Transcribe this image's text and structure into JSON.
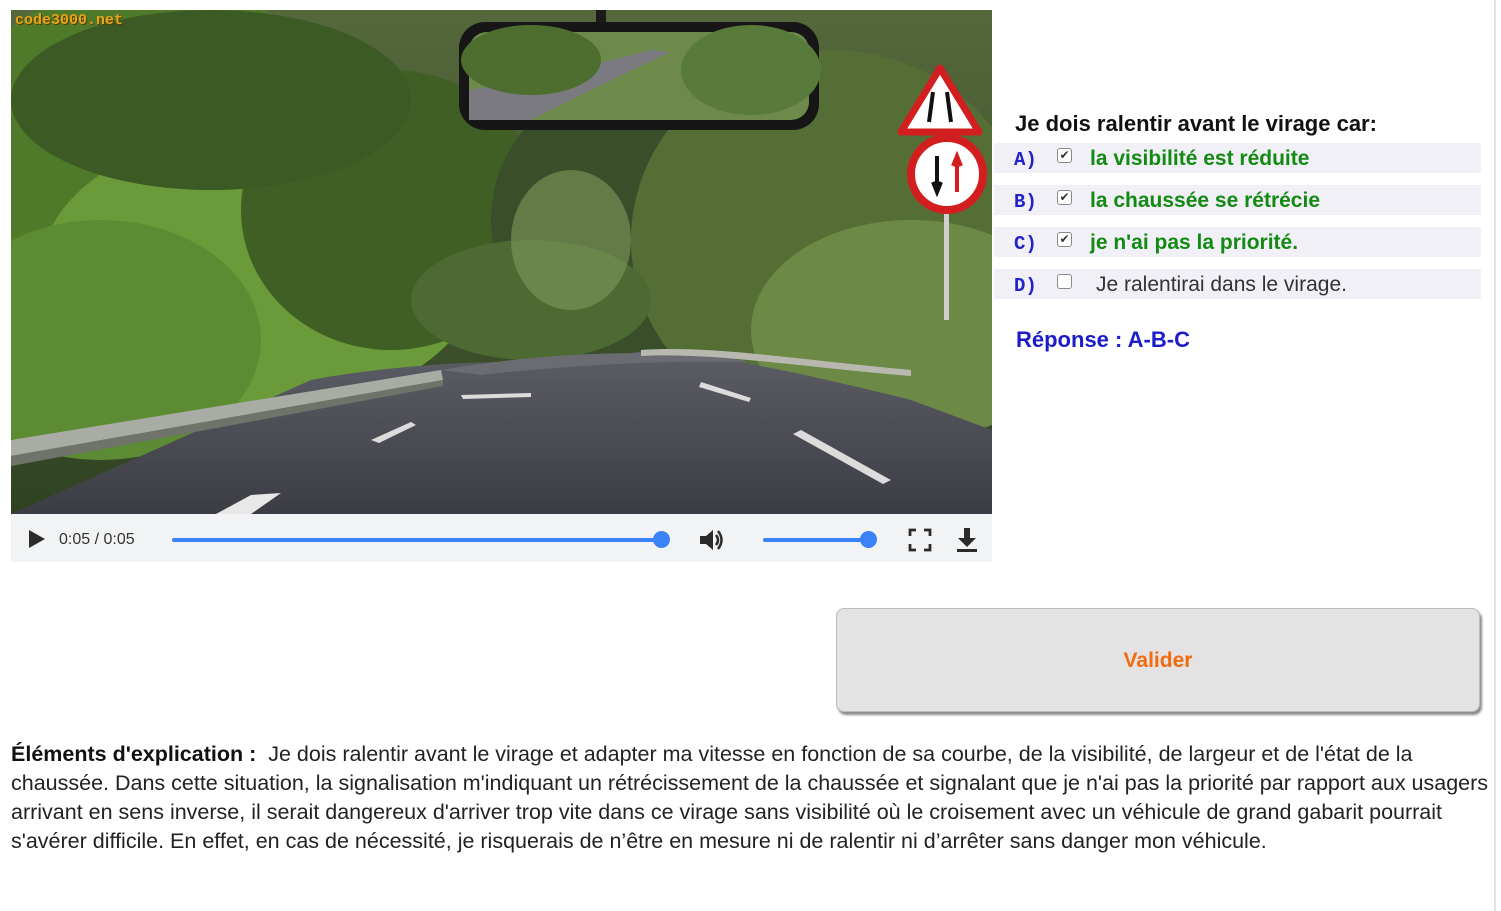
{
  "video": {
    "watermark": "code3000.net",
    "current_time": "0:05",
    "duration": "0:05",
    "progress_fraction": 1.0,
    "volume_fraction": 1.0
  },
  "question": {
    "title": "Je dois ralentir avant le virage car:",
    "answers": [
      {
        "letter": "A)",
        "text": "la visibilité est réduite",
        "checked": true
      },
      {
        "letter": "B)",
        "text": "la chaussée se rétrécie",
        "checked": true
      },
      {
        "letter": "C)",
        "text": "je n'ai pas la priorité.",
        "checked": true
      },
      {
        "letter": "D)",
        "text": "Je ralentirai dans le virage.",
        "checked": false
      }
    ],
    "response": "Réponse : A-B-C"
  },
  "validate_label": "Valider",
  "explanation": {
    "label": "Éléments d'explication :",
    "text": "Je dois ralentir avant le virage et adapter ma vitesse en fonction de sa courbe, de la visibilité, de largeur et de l'état de la chaussée. Dans cette situation, la signalisation m'indiquant un rétrécissement de la chaussée et signalant que je n'ai pas la priorité par rapport aux usagers arrivant en sens inverse, il serait dangereux d'arriver trop vite dans ce virage sans visibilité où le croisement avec un véhicule de grand gabarit pourrait s'avérer difficile. En effet, en cas de nécessité, je risquerais de n’être en mesure ni de ralentir ni d’arrêter sans danger mon véhicule."
  },
  "colors": {
    "correct_answer": "#138a13",
    "letter": "#2222cc",
    "response": "#1c1ccc",
    "validate_text": "#f26b0f",
    "player_accent": "#3b82f6"
  },
  "icons": [
    "play-icon",
    "volume-icon",
    "fullscreen-icon",
    "download-icon"
  ]
}
